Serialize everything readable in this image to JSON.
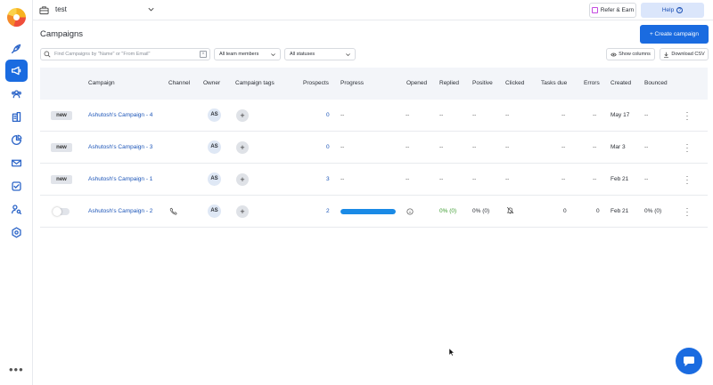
{
  "workspace": {
    "name": "test"
  },
  "topbar": {
    "refer_label": "Refer & Earn",
    "help_label": "Help"
  },
  "page": {
    "title": "Campaigns",
    "create_label": "+ Create campaign"
  },
  "filters": {
    "search_placeholder": "Find Campaigns by \"Name\" or \"From Email\"",
    "team_members": "All team members",
    "statuses": "All statuses",
    "show_columns": "Show columns",
    "download_csv": "Download CSV"
  },
  "columns": [
    "Campaign",
    "Channel",
    "Owner",
    "Campaign tags",
    "Prospects",
    "Progress",
    "Opened",
    "Replied",
    "Positive",
    "Clicked",
    "Tasks due",
    "Errors",
    "Created",
    "Bounced"
  ],
  "rows": [
    {
      "status": "new",
      "name": "Ashutosh's Campaign - 4",
      "owner": "AS",
      "prospects": "0",
      "progress": "--",
      "opened": "--",
      "replied": "--",
      "positive": "--",
      "clicked": "--",
      "tasks_due": "--",
      "errors": "--",
      "created": "May 17",
      "bounced": "--"
    },
    {
      "status": "new",
      "name": "Ashutosh's Campaign - 3",
      "owner": "AS",
      "prospects": "0",
      "progress": "--",
      "opened": "--",
      "replied": "--",
      "positive": "--",
      "clicked": "--",
      "tasks_due": "--",
      "errors": "--",
      "created": "Mar 3",
      "bounced": "--"
    },
    {
      "status": "new",
      "name": "Ashutosh's Campaign - 1",
      "owner": "AS",
      "prospects": "3",
      "progress": "--",
      "opened": "--",
      "replied": "--",
      "positive": "--",
      "clicked": "--",
      "tasks_due": "--",
      "errors": "--",
      "created": "Feb 21",
      "bounced": "--"
    },
    {
      "status": "toggle-off",
      "name": "Ashutosh's Campaign - 2",
      "owner": "AS",
      "prospects": "2",
      "progress_fraction": 1.0,
      "replied": "0% (0)",
      "positive": "0% (0)",
      "tasks_due": "0",
      "errors": "0",
      "created": "Feb 21",
      "bounced": "0% (0)"
    }
  ],
  "colors": {
    "accent": "#1a6be0",
    "link": "#1c55b8",
    "progress": "#1a8ae6",
    "replied_green": "#3b9b2e"
  },
  "icons": [
    "logo",
    "rocket-icon",
    "megaphone-icon",
    "users-icon",
    "building-icon",
    "pie-chart-icon",
    "mail-icon",
    "checkbox-icon",
    "user-search-icon",
    "settings-hexagon-icon",
    "more-icon",
    "briefcase-icon",
    "chevron-down-icon",
    "gift-icon",
    "help-circle-icon",
    "search-icon",
    "clear-icon",
    "eye-icon",
    "download-icon",
    "phone-icon",
    "info-icon",
    "bell-off-icon",
    "kebab-icon",
    "chat-icon"
  ]
}
